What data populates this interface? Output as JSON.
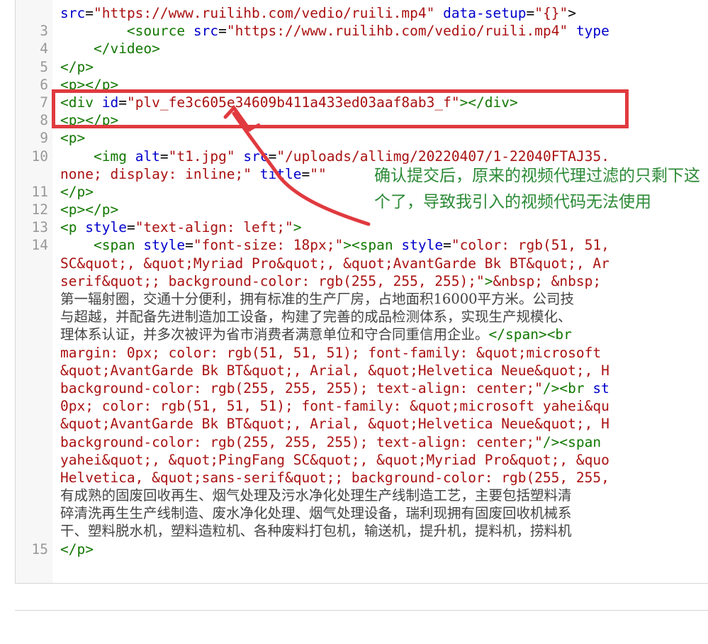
{
  "editor": {
    "lines": [
      {
        "num": "",
        "html": "<span class='att'>src</span>=<span class='str'>\"https://www.ruilihb.com/vedio/ruili.mp4\"</span> <span class='att'>data-setup</span>=<span class='str'>\"{}\"</span>&gt;"
      },
      {
        "num": "3",
        "html": "        <span class='tag'>&lt;source</span> <span class='att'>src</span>=<span class='str'>\"https://www.ruilihb.com/vedio/ruili.mp4\"</span> <span class='att'>type</span>"
      },
      {
        "num": "4",
        "html": "    <span class='tag'>&lt;/video&gt;</span>"
      },
      {
        "num": "5",
        "html": "<span class='tag'>&lt;/p&gt;</span>"
      },
      {
        "num": "6",
        "html": "<span class='tag'>&lt;p&gt;&lt;/p&gt;</span>"
      },
      {
        "num": "7",
        "html": "<span class='tag'>&lt;div</span> <span class='att'>id</span>=<span class='str'>\"plv_fe3c605e34609b411a433ed03aaf8ab3_f\"</span><span class='tag'>&gt;&lt;/div&gt;</span>"
      },
      {
        "num": "8",
        "html": "<span class='tag'>&lt;p&gt;&lt;/p&gt;</span>"
      },
      {
        "num": "9",
        "html": "<span class='tag'>&lt;p&gt;</span>"
      },
      {
        "num": "10",
        "html": "    <span class='tag'>&lt;img</span> <span class='att'>alt</span>=<span class='str'>\"t1.jpg\"</span> <span class='att'>src</span>=<span class='str'>\"/uploads/allimg/20220407/1-22040FTAJ35.</span>"
      },
      {
        "num": "",
        "html": "<span class='str'>none; display: inline;\"</span> <span class='att'>title</span>=<span class='str'>\"\"</span>"
      },
      {
        "num": "11",
        "html": "<span class='tag'>&lt;/p&gt;</span>"
      },
      {
        "num": "12",
        "html": "<span class='tag'>&lt;p&gt;&lt;/p&gt;</span>"
      },
      {
        "num": "13",
        "html": "<span class='tag'>&lt;p</span> <span class='att'>style</span>=<span class='str'>\"text-align: left;\"</span><span class='tag'>&gt;</span>"
      },
      {
        "num": "14",
        "html": "    <span class='tag'>&lt;span</span> <span class='att'>style</span>=<span class='str'>\"font-size: 18px;\"</span><span class='tag'>&gt;&lt;span</span> <span class='att'>style</span>=<span class='str'>\"color: rgb(51, 51,</span>"
      },
      {
        "num": "",
        "html": "<span class='str'>SC&amp;quot;, &amp;quot;Myriad Pro&amp;quot;, &amp;quot;AvantGarde Bk BT&amp;quot;, Ar</span>"
      },
      {
        "num": "",
        "html": "<span class='str'>serif&amp;quot;; background-color: rgb(255, 255, 255);\"</span><span class='tag'>&gt;</span><span class='ent'>&amp;nbsp; &amp;nbsp;</span>"
      },
      {
        "num": "",
        "html": "<span class='cjk'>第一辐射圈，交通十分便利，拥有标准的生产厂房，占地面积16000平方米。公司技</span>"
      },
      {
        "num": "",
        "html": "<span class='cjk'>与超越，并配备先进制造加工设备，构建了完善的成品检测体系，实现生产规模化、</span>"
      },
      {
        "num": "",
        "html": "<span class='cjk'>理体系认证，并多次被评为省市消费者满意单位和守合同重信用企业。</span><span class='tag'>&lt;/span&gt;&lt;br</span>"
      },
      {
        "num": "",
        "html": "<span class='str'>margin: 0px; color: rgb(51, 51, 51); font-family: &amp;quot;microsoft</span>"
      },
      {
        "num": "",
        "html": "<span class='str'>&amp;quot;AvantGarde Bk BT&amp;quot;, Arial, &amp;quot;Helvetica Neue&amp;quot;, H</span>"
      },
      {
        "num": "",
        "html": "<span class='str'>background-color: rgb(255, 255, 255); text-align: center;\"</span><span class='tag'>/&gt;&lt;br</span> <span class='att'>st</span>"
      },
      {
        "num": "",
        "html": "<span class='str'>0px; color: rgb(51, 51, 51); font-family: &amp;quot;microsoft yahei&amp;qu</span>"
      },
      {
        "num": "",
        "html": "<span class='str'>&amp;quot;AvantGarde Bk BT&amp;quot;, Arial, &amp;quot;Helvetica Neue&amp;quot;, H</span>"
      },
      {
        "num": "",
        "html": "<span class='str'>background-color: rgb(255, 255, 255); text-align: center;\"</span><span class='tag'>/&gt;&lt;span</span>"
      },
      {
        "num": "",
        "html": "<span class='str'>yahei&amp;quot;, &amp;quot;PingFang SC&amp;quot;, &amp;quot;Myriad Pro&amp;quot;, &amp;quo</span>"
      },
      {
        "num": "",
        "html": "<span class='str'>Helvetica, &amp;quot;sans-serif&amp;quot;; background-color: rgb(255, 255,</span>"
      },
      {
        "num": "",
        "html": "<span class='cjk'>有成熟的固废回收再生、烟气处理及污水净化处理生产线制造工艺，主要包括塑料清</span>"
      },
      {
        "num": "",
        "html": "<span class='cjk'>碎清洗再生生产线制造、废水净化处理、烟气处理设备，瑞利现拥有固废回收机械系</span>"
      },
      {
        "num": "",
        "html": "<span class='cjk'>干、塑料脱水机，塑料造粒机、各种废料打包机，输送机，提升机，提料机，捞料机</span>"
      },
      {
        "num": "15",
        "html": "<span class='tag'>&lt;/p&gt;</span>"
      }
    ]
  },
  "annotation": {
    "text": "确认提交后，原来的视频代理过滤的只剩下这个了，导致我引入的视频代码无法使用"
  },
  "colors": {
    "highlight_box": "#e03a3f",
    "annotation_text": "#2c8a36",
    "tag": "#117700",
    "attribute": "#0000cc",
    "string": "#aa1111",
    "line_number": "#999999"
  }
}
